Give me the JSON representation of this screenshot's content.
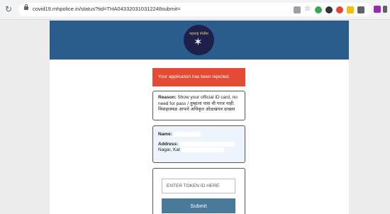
{
  "browser": {
    "url": "covid19.mhpolice.in/status?tid=THA043320310312248submit="
  },
  "header": {
    "logo_text": "महाराष्ट्र पोलीस"
  },
  "status": {
    "message": "Your application has been rejected."
  },
  "reason": {
    "label": "Reason:",
    "english": "Show your official ID card, no need for pass /",
    "marathi_1": "तुम्हाला पास ची गरज नाही.",
    "marathi_2": "विवाहास्थळ आपले अधिकृत ओळखपत्र दाखवा"
  },
  "applicant": {
    "name_label": "Name:",
    "address_label": "Address:",
    "address_partial": "Nagar, Kat"
  },
  "token": {
    "placeholder": "ENTER TOKEN ID HERE",
    "submit_label": "Submit"
  }
}
